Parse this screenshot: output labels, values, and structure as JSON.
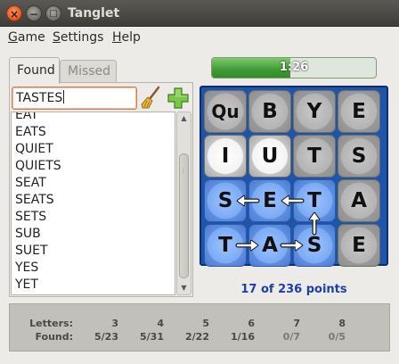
{
  "window": {
    "title": "Tanglet"
  },
  "menu": {
    "game": {
      "underline": "G",
      "rest": "ame"
    },
    "settings": {
      "underline": "S",
      "rest": "ettings"
    },
    "help": {
      "underline": "H",
      "rest": "elp"
    }
  },
  "tabs": {
    "found": "Found",
    "missed": "Missed"
  },
  "input": {
    "value": "TASTES"
  },
  "words": [
    "EAT",
    "EATS",
    "QUIET",
    "QUIETS",
    "SEAT",
    "SEATS",
    "SETS",
    "SUB",
    "SUET",
    "YES",
    "YET"
  ],
  "timer": {
    "text": "1:26",
    "fraction_remaining": 0.48
  },
  "board": {
    "letters": [
      [
        "Qu",
        "B",
        "Y",
        "E"
      ],
      [
        "I",
        "U",
        "T",
        "S"
      ],
      [
        "S",
        "E",
        "T",
        "A"
      ],
      [
        "T",
        "A",
        "S",
        "E"
      ]
    ],
    "white_tiles": [
      [
        1,
        0
      ],
      [
        1,
        1
      ]
    ],
    "selected_path": [
      [
        3,
        0
      ],
      [
        3,
        1
      ],
      [
        3,
        2
      ],
      [
        2,
        2
      ],
      [
        2,
        1
      ],
      [
        2,
        0
      ]
    ]
  },
  "points_text": "17 of 236 points",
  "stats": {
    "letters_label": "Letters:",
    "found_label": "Found:",
    "lengths": [
      "3",
      "4",
      "5",
      "6",
      "7",
      "8"
    ],
    "found": [
      "5/23",
      "5/31",
      "2/22",
      "1/16",
      "0/7",
      "0/5"
    ]
  },
  "colors": {
    "board": "#1f55a8",
    "selected_tile": "#7aaaf4",
    "points_text": "#1d3fa6",
    "timer_fill": "#3f9b34"
  }
}
